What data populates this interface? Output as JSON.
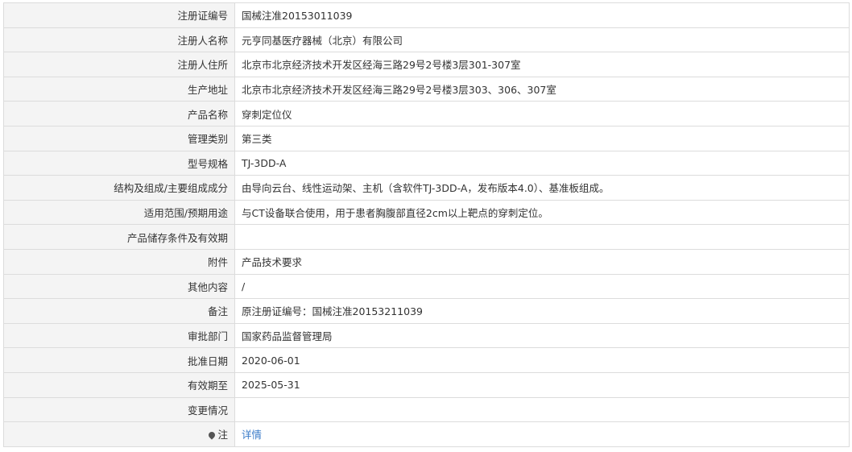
{
  "rows": [
    {
      "label": "注册证编号",
      "value": "国械注准20153011039"
    },
    {
      "label": "注册人名称",
      "value": "元亨同基医疗器械（北京）有限公司"
    },
    {
      "label": "注册人住所",
      "value": "北京市北京经济技术开发区经海三路29号2号楼3层301-307室"
    },
    {
      "label": "生产地址",
      "value": "北京市北京经济技术开发区经海三路29号2号楼3层303、306、307室"
    },
    {
      "label": "产品名称",
      "value": "穿刺定位仪"
    },
    {
      "label": "管理类别",
      "value": "第三类"
    },
    {
      "label": "型号规格",
      "value": "TJ-3DD-A"
    },
    {
      "label": "结构及组成/主要组成成分",
      "value": "由导向云台、线性运动架、主机（含软件TJ-3DD-A，发布版本4.0）、基准板组成。"
    },
    {
      "label": "适用范围/预期用途",
      "value": "与CT设备联合使用，用于患者胸腹部直径2cm以上靶点的穿刺定位。"
    },
    {
      "label": "产品储存条件及有效期",
      "value": ""
    },
    {
      "label": "附件",
      "value": "产品技术要求"
    },
    {
      "label": "其他内容",
      "value": "/"
    },
    {
      "label": "备注",
      "value": "原注册证编号：国械注准20153211039"
    },
    {
      "label": "审批部门",
      "value": "国家药品监督管理局"
    },
    {
      "label": "批准日期",
      "value": "2020-06-01"
    },
    {
      "label": "有效期至",
      "value": "2025-05-31"
    },
    {
      "label": "变更情况",
      "value": ""
    }
  ],
  "note_row": {
    "label": "注",
    "icon": "pin-icon",
    "link_text": "详情"
  },
  "colors": {
    "label_bg": "#f4f4f4",
    "border": "#dcdcdc",
    "link": "#3a7bc8"
  }
}
